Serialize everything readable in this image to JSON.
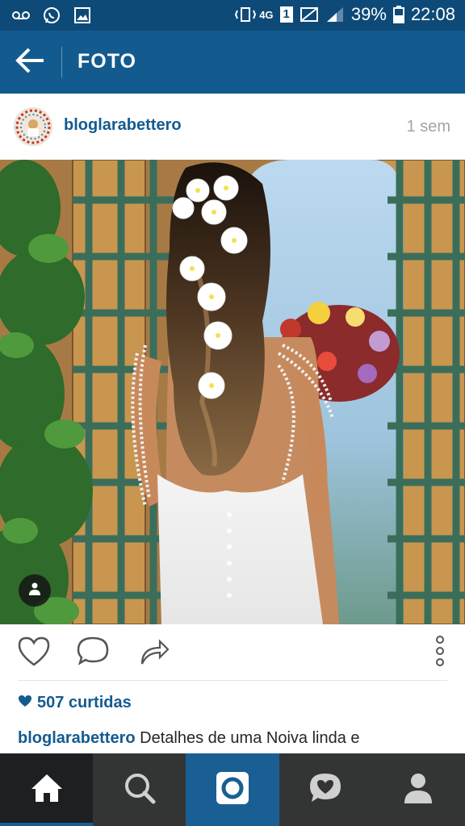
{
  "status_bar": {
    "network": "4G",
    "sim_slot": "1",
    "battery": "39%",
    "time": "22:08",
    "icons_left": [
      "voicemail-icon",
      "whatsapp-icon",
      "gallery-icon"
    ],
    "icons_right": [
      "vibrate-icon",
      "data-icon",
      "sim-icon",
      "no-signal-icon",
      "signal-icon",
      "battery-icon"
    ]
  },
  "app_bar": {
    "title": "FOTO",
    "back_icon": "arrow-left-icon"
  },
  "post": {
    "username": "bloglarabettero",
    "time_ago": "1 sem",
    "likes": "507 curtidas",
    "caption_user": "bloglarabettero",
    "caption_text": "Detalhes de uma Noiva linda e"
  },
  "actions": {
    "icons": [
      "heart-icon",
      "comment-icon",
      "share-icon",
      "more-vertical-icon"
    ]
  },
  "bottom_nav": {
    "items": [
      "home",
      "search",
      "camera",
      "activity",
      "profile"
    ],
    "active": "home"
  },
  "colors": {
    "status_bar": "#0e4a78",
    "app_bar": "#135b8f",
    "accent": "#135b8f",
    "nav_bg": "#333535"
  }
}
